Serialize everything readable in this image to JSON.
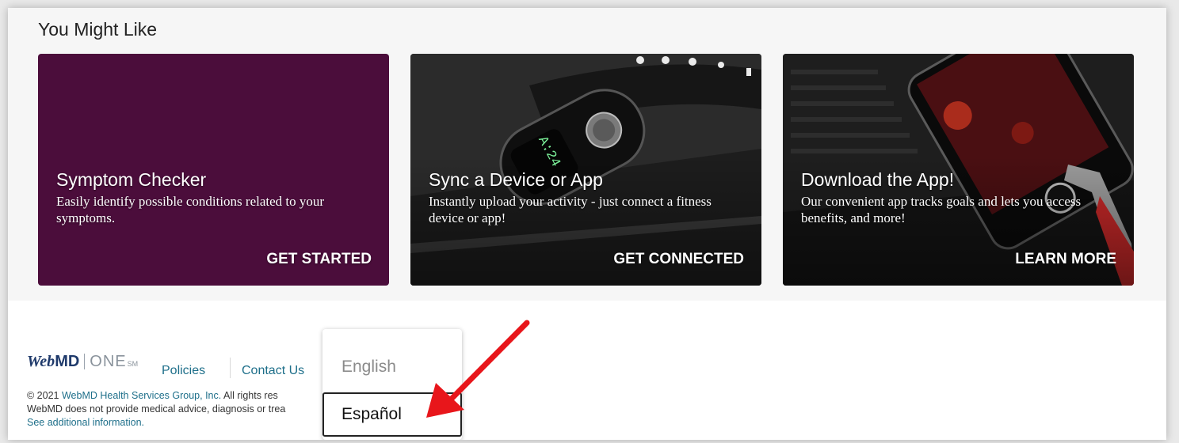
{
  "section": {
    "title": "You Might Like"
  },
  "cards": [
    {
      "title": "Symptom Checker",
      "description": "Easily identify possible conditions related to your symptoms.",
      "cta": "GET STARTED",
      "color": "#4b0d3b"
    },
    {
      "title": "Sync a Device or App",
      "description": "Instantly upload your activity - just connect a fitness device or app!",
      "cta": "GET CONNECTED",
      "device_display": "A:24"
    },
    {
      "title": "Download the App!",
      "description": "Our convenient app tracks goals and lets you access benefits, and more!",
      "cta": "LEARN MORE"
    }
  ],
  "footer": {
    "brand": {
      "web": "Web",
      "md": "MD",
      "one": "ONE",
      "sm": "SM"
    },
    "links": {
      "policies": "Policies",
      "contact": "Contact Us"
    },
    "legal": {
      "copyright_prefix": "© 2021",
      "company": "WebMD Health Services Group, Inc.",
      "rights": "All rights res",
      "disclaimer": "WebMD does not provide medical advice, diagnosis or trea",
      "more": "See additional information."
    }
  },
  "language_menu": {
    "options": [
      "English",
      "Español"
    ],
    "selected": "Español"
  },
  "annotation": {
    "arrow_color": "#e8161b"
  }
}
